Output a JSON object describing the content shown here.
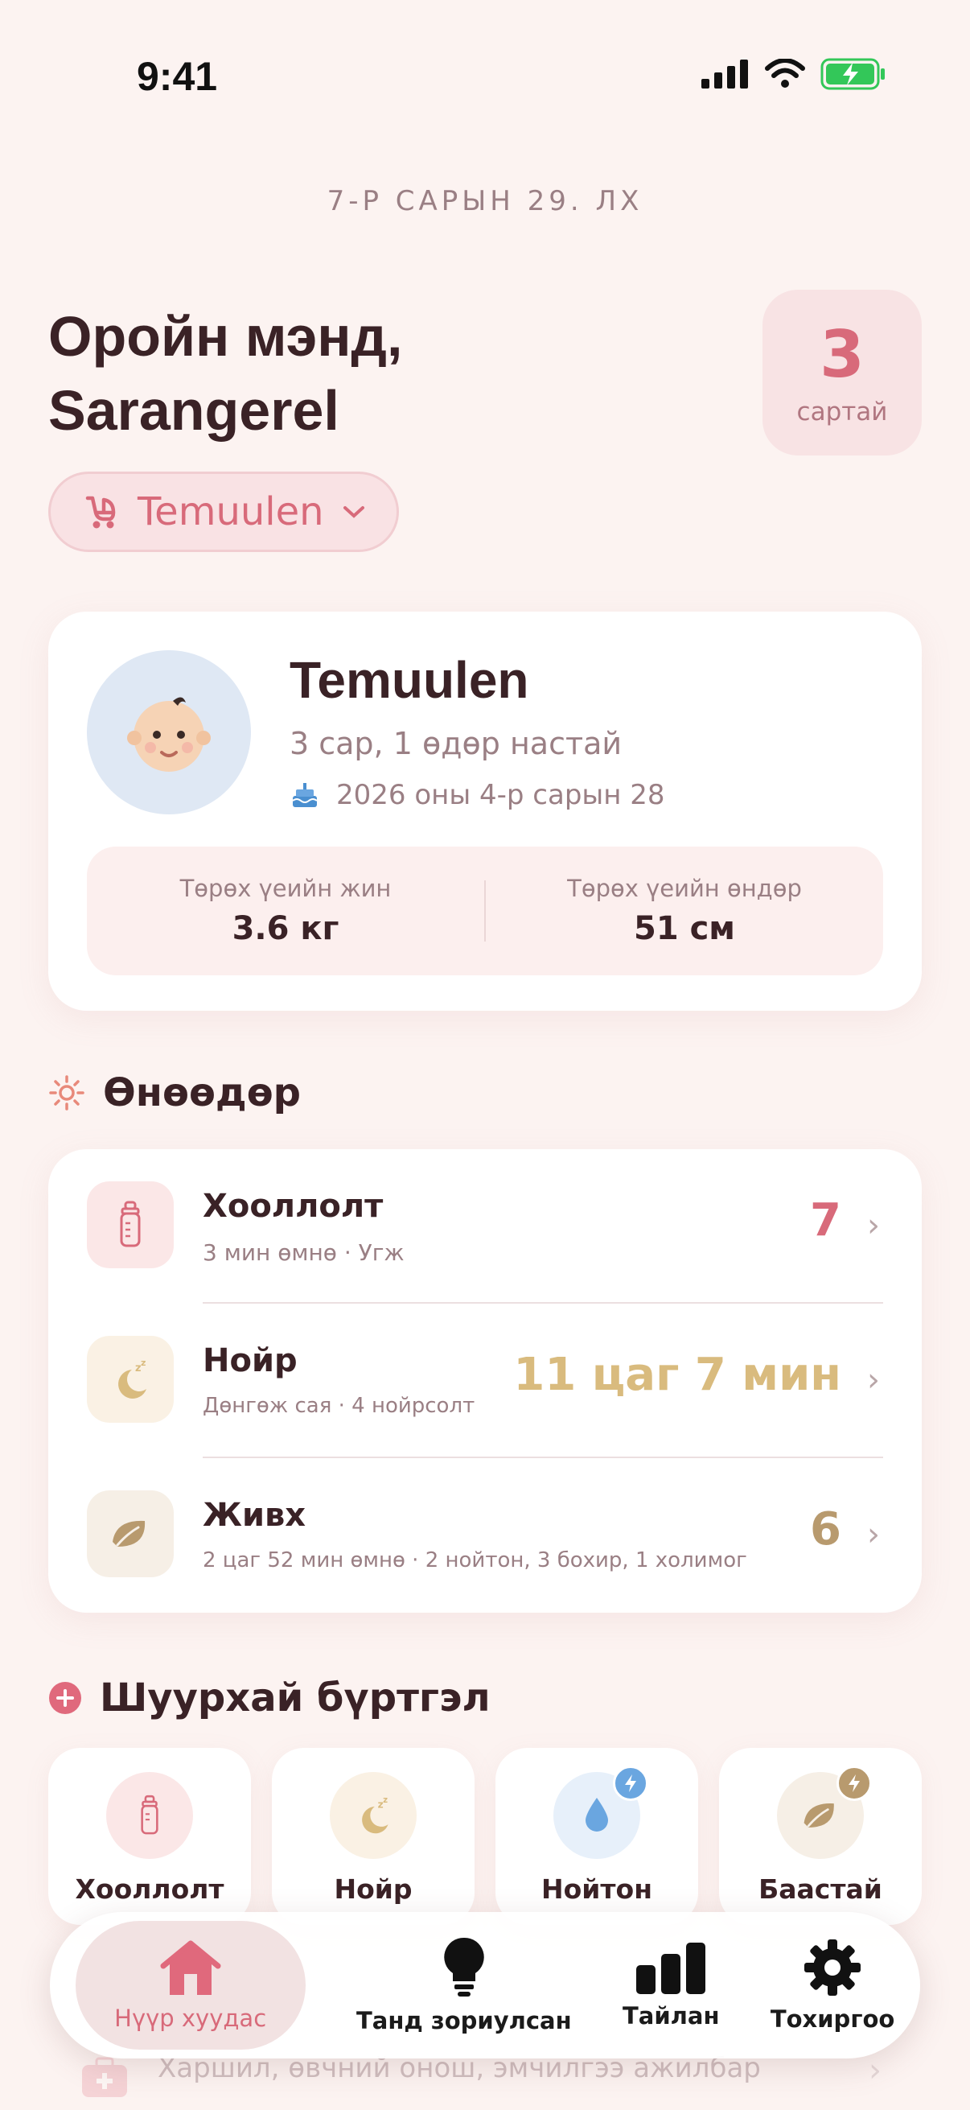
{
  "status_bar": {
    "time": "9:41"
  },
  "date": "7-Р САРЫН 29. ЛХ",
  "greeting": {
    "line1": "Оройн мэнд,",
    "line2": "Sarangerel"
  },
  "age_badge": {
    "value": "3",
    "unit": "сартай"
  },
  "baby_selector": {
    "name": "Temuulen"
  },
  "profile": {
    "name": "Temuulen",
    "age": "3 сар, 1 өдөр настай",
    "birthdate": "2026 оны 4-р сарын 28",
    "birth_weight_label": "Төрөх үеийн жин",
    "birth_weight": "3.6 кг",
    "birth_height_label": "Төрөх үеийн өндөр",
    "birth_height": "51 см"
  },
  "today": {
    "title": "Өнөөдөр",
    "rows": [
      {
        "title": "Хооллолт",
        "subtitle": "3 мин өмнө · Угж",
        "value": "7",
        "color": "#d86a7a"
      },
      {
        "title": "Нойр",
        "subtitle": "Дөнгөж сая · 4 нойрсолт",
        "value": "11 цаг 7 мин",
        "color": "#d9bb7e"
      },
      {
        "title": "Живх",
        "subtitle": "2 цаг 52 мин өмнө · 2 нойтон, 3 бохир, 1 холимог",
        "value": "6",
        "color": "#b89a6e"
      }
    ]
  },
  "quick_log": {
    "title": "Шуурхай бүртгэл",
    "buttons": [
      {
        "label": "Хооллолт"
      },
      {
        "label": "Нойр"
      },
      {
        "label": "Нойтон"
      },
      {
        "label": "Баастай"
      }
    ]
  },
  "hidden_row": {
    "text": "Харшил, өвчний онош, эмчилгээ ажилбар"
  },
  "tabs": [
    {
      "label": "Нүүр хуудас",
      "active": true
    },
    {
      "label": "Танд зориулсан"
    },
    {
      "label": "Тайлан"
    },
    {
      "label": "Тохиргоо"
    }
  ],
  "colors": {
    "accent": "#d86a7a",
    "background": "#fcf3f1",
    "sleep": "#d9bb7e",
    "diaper": "#b89a6e",
    "water": "#6aa6e0"
  }
}
